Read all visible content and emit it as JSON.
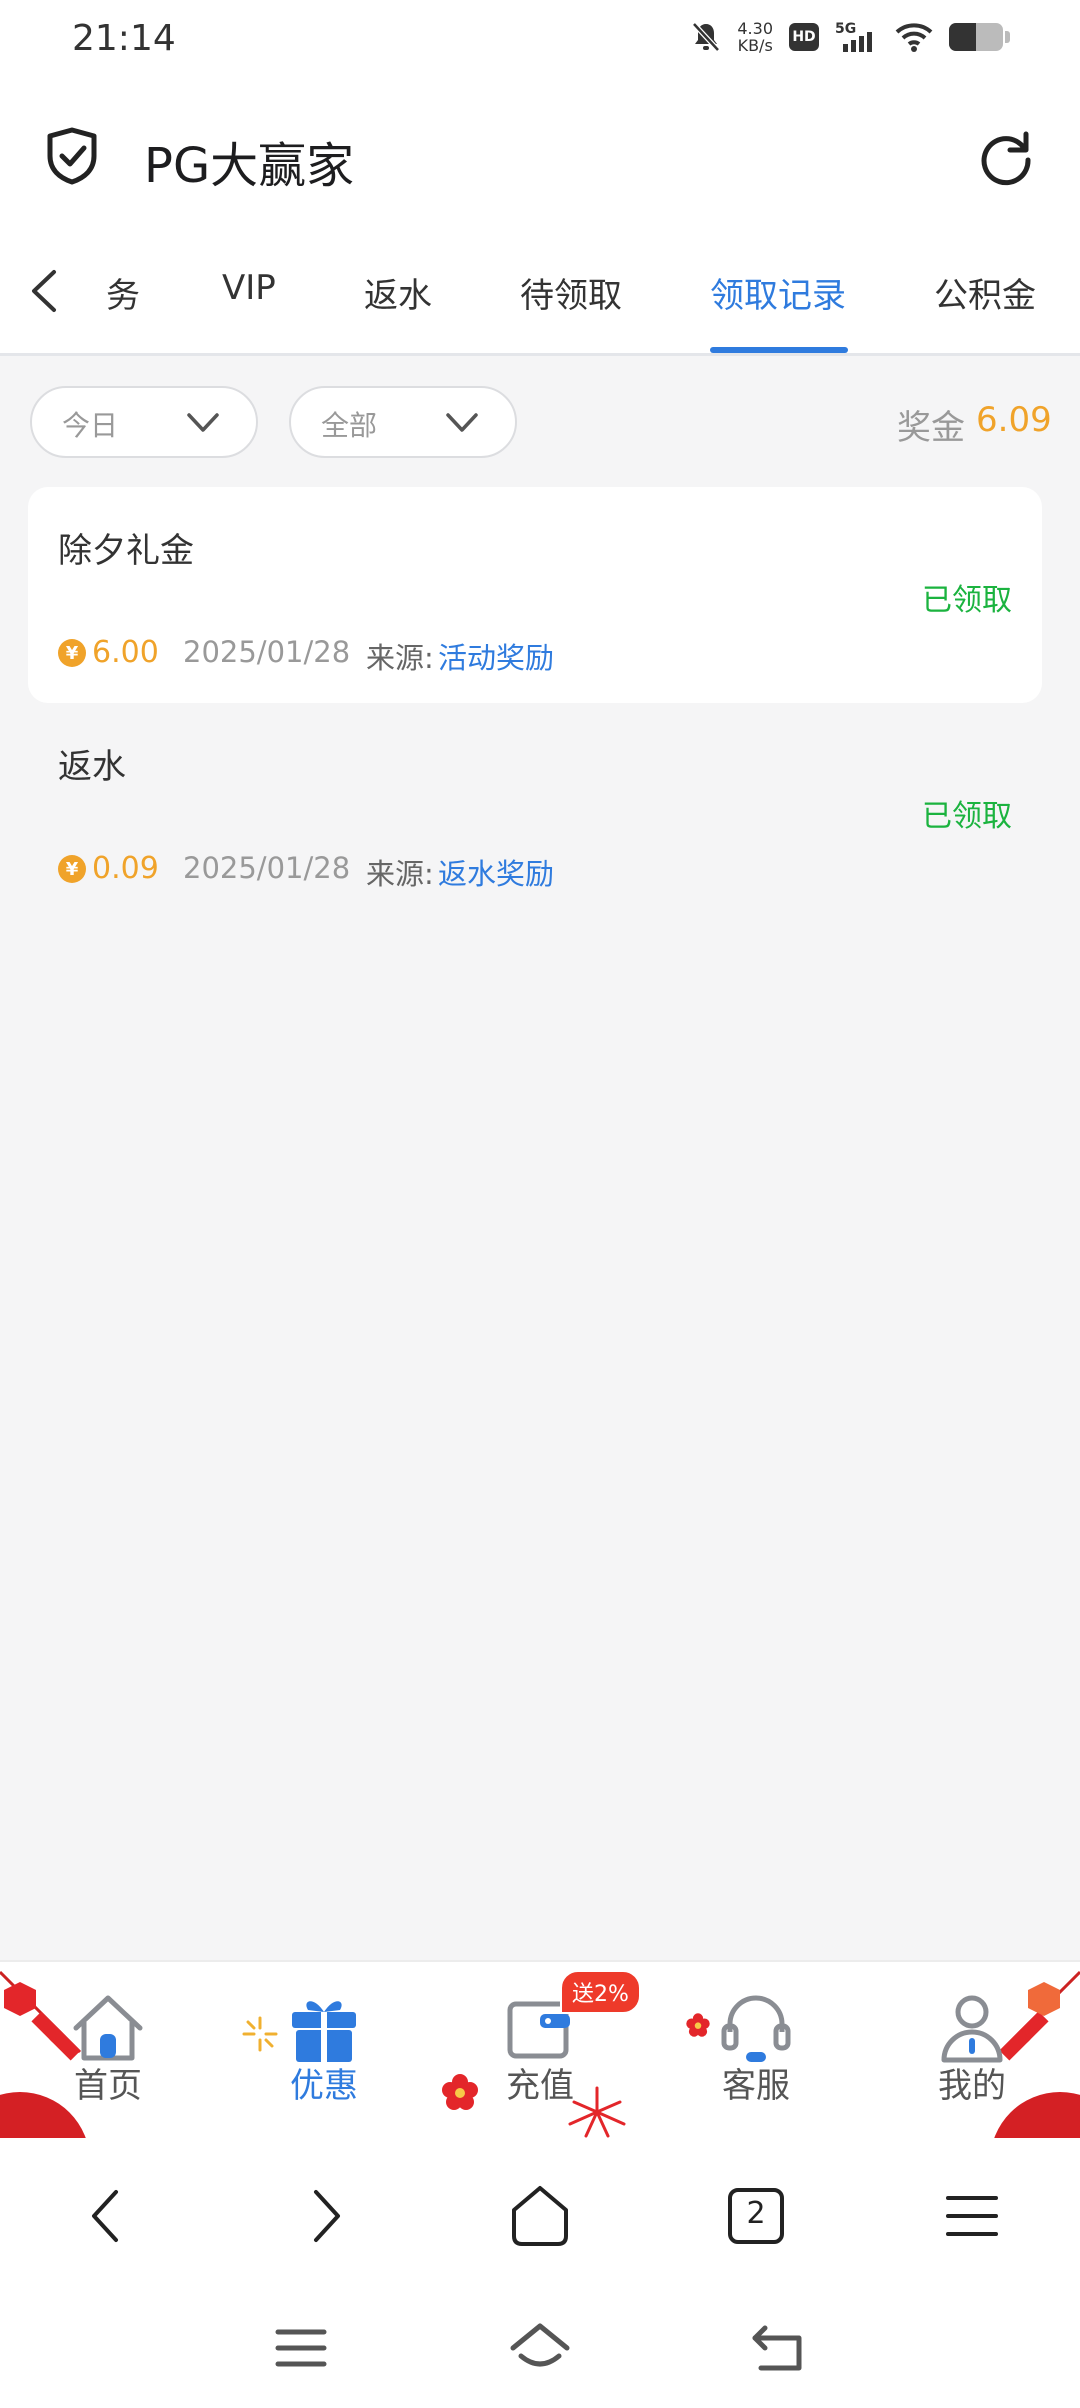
{
  "status_bar": {
    "time": "21:14",
    "speed_value": "4.30",
    "speed_unit": "KB/s",
    "hd": "HD",
    "network": "5G"
  },
  "header": {
    "title": "PG大赢家"
  },
  "tabs": [
    {
      "label": "务",
      "active": false
    },
    {
      "label": "VIP",
      "active": false
    },
    {
      "label": "返水",
      "active": false
    },
    {
      "label": "待领取",
      "active": false
    },
    {
      "label": "领取记录",
      "active": true
    },
    {
      "label": "公积金",
      "active": false
    }
  ],
  "filters": {
    "date": {
      "value": "今日"
    },
    "type": {
      "value": "全部"
    }
  },
  "summary": {
    "label": "奖金",
    "value": "6.09"
  },
  "records": [
    {
      "title": "除夕礼金",
      "status": "已领取",
      "coin_symbol": "¥",
      "amount": "6.00",
      "date": "2025/01/28",
      "source_label": "来源:",
      "source_value": "活动奖励"
    },
    {
      "title": "返水",
      "status": "已领取",
      "coin_symbol": "¥",
      "amount": "0.09",
      "date": "2025/01/28",
      "source_label": "来源:",
      "source_value": "返水奖励"
    }
  ],
  "bottom_nav": {
    "items": [
      {
        "label": "首页",
        "icon": "home-icon",
        "active": false
      },
      {
        "label": "优惠",
        "icon": "gift-icon",
        "active": true
      },
      {
        "label": "充值",
        "icon": "wallet-icon",
        "active": false
      },
      {
        "label": "客服",
        "icon": "headset-icon",
        "active": false
      },
      {
        "label": "我的",
        "icon": "user-icon",
        "active": false
      }
    ],
    "promo_badge": "送2%"
  },
  "browser_toolbar": {
    "tab_count": "2"
  },
  "colors": {
    "accent": "#2f7bde",
    "gold": "#f0a32a",
    "success": "#1bb33f",
    "festive_red": "#e3262a"
  }
}
